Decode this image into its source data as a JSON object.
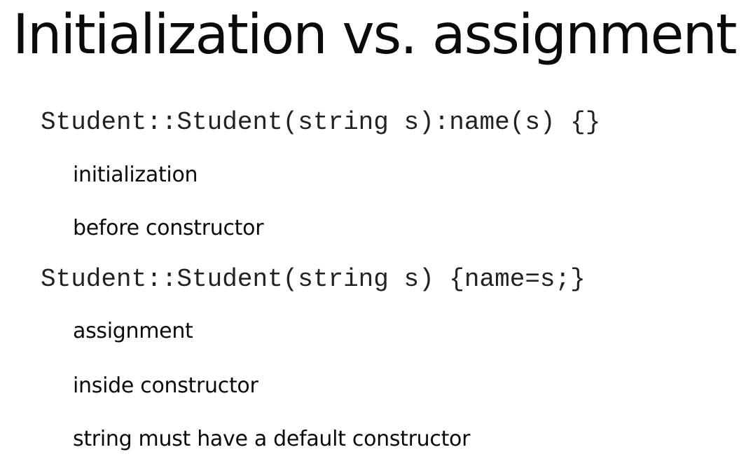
{
  "title": "Initialization vs. assignment",
  "sections": [
    {
      "code": "Student::Student(string s):name(s) {}",
      "points": [
        "initialization",
        "before constructor"
      ]
    },
    {
      "code": "Student::Student(string s) {name=s;}",
      "points": [
        "assignment",
        "inside constructor",
        "string must have a default constructor"
      ]
    }
  ]
}
